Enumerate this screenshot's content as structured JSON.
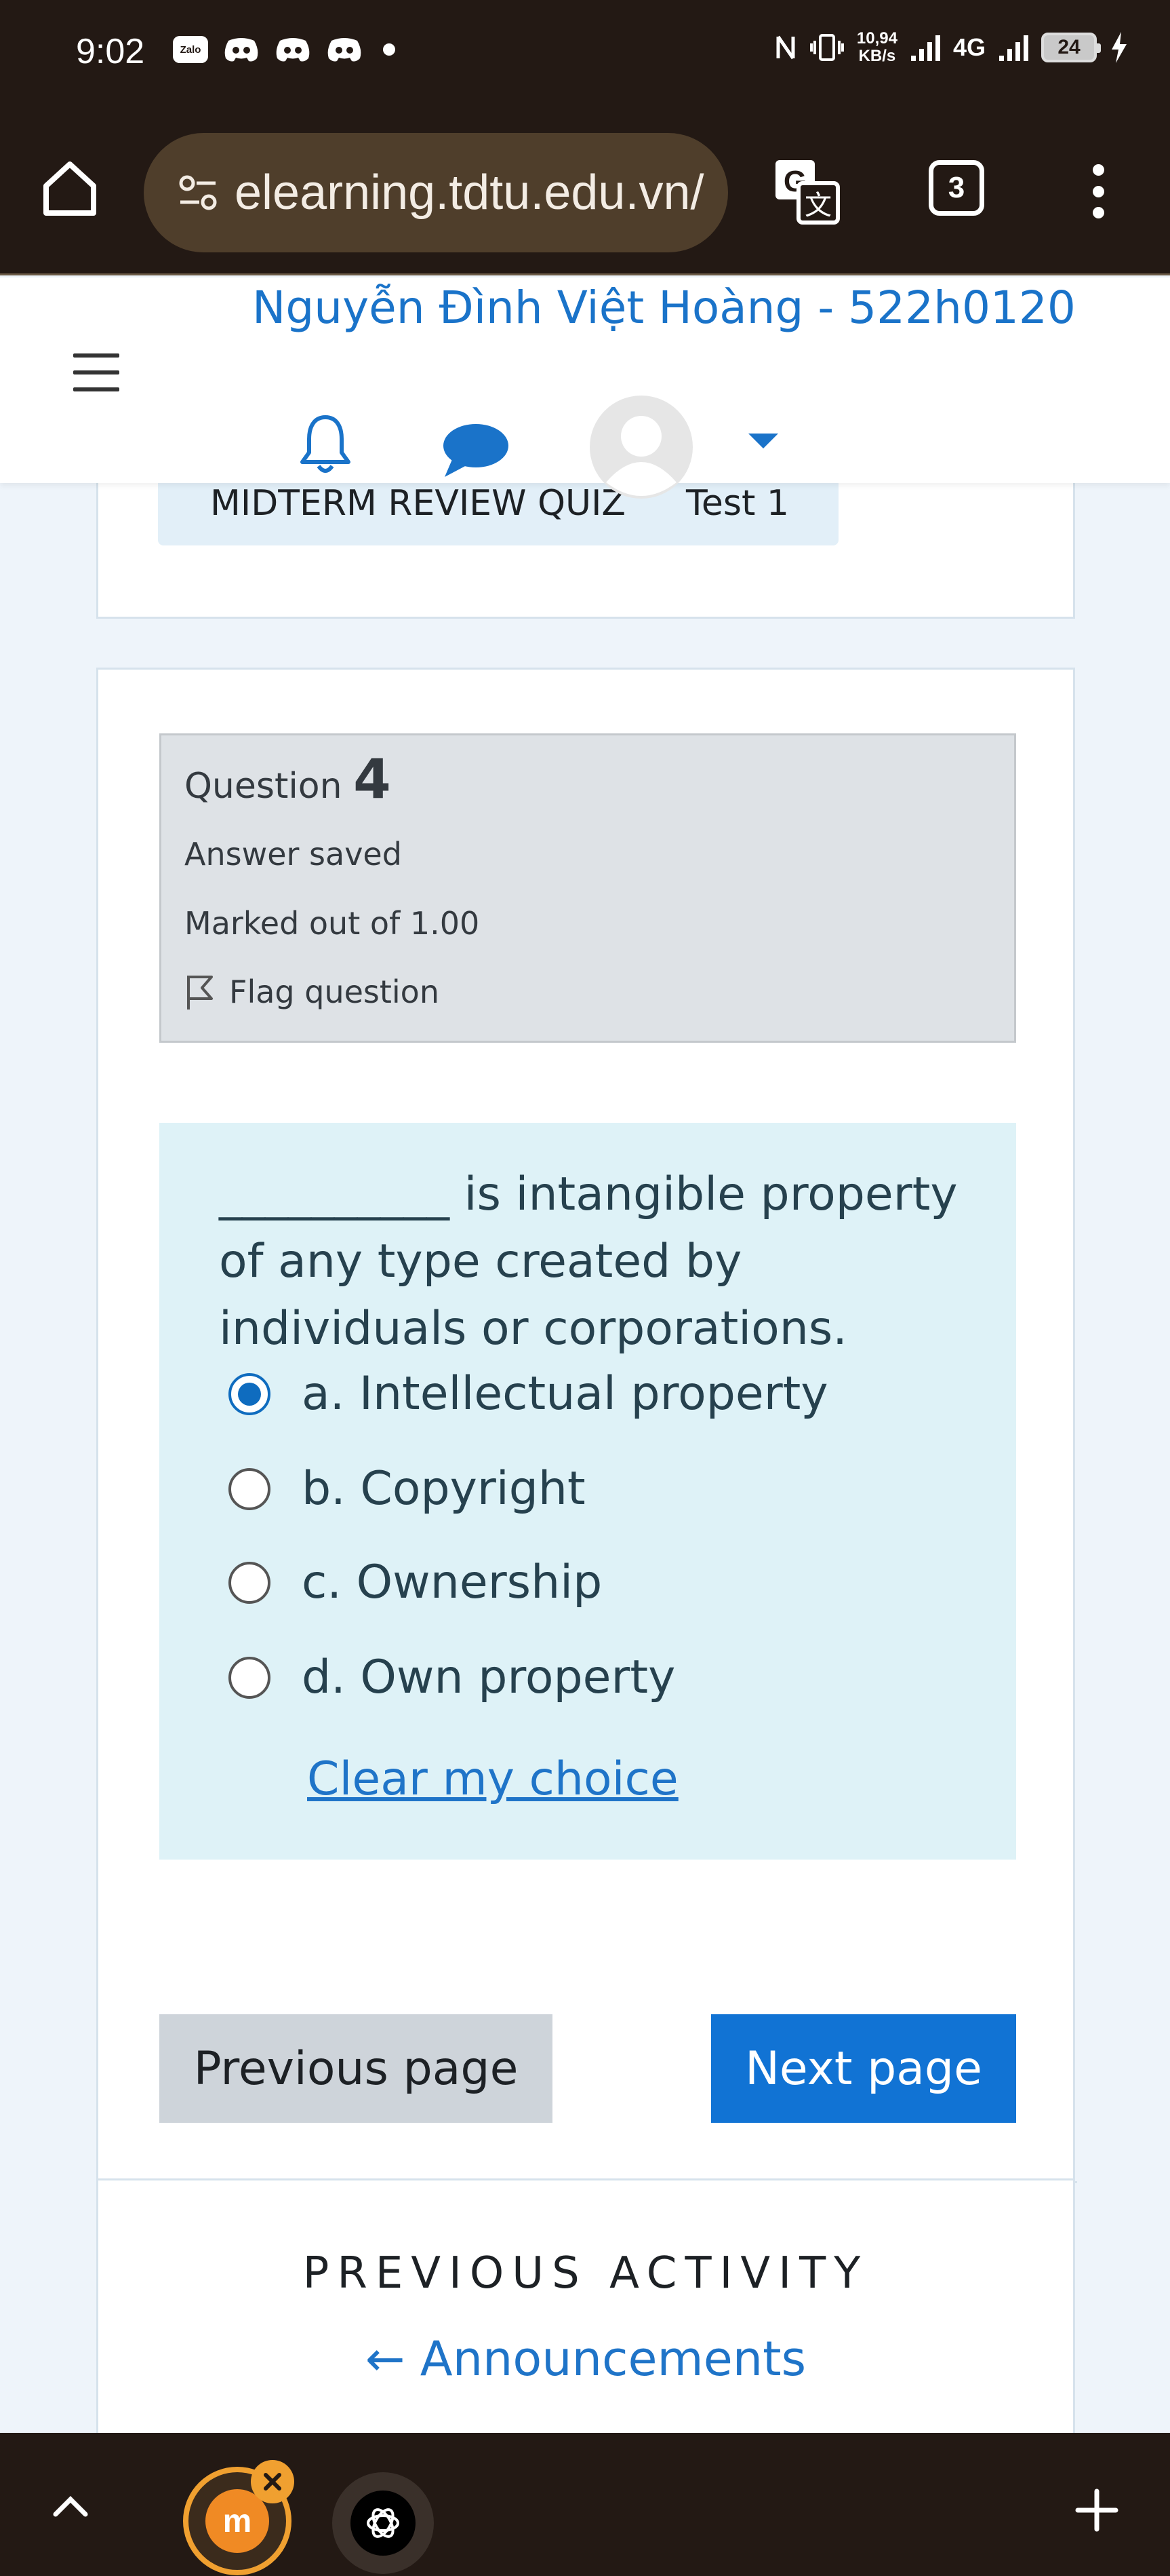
{
  "status_bar": {
    "time": "9:02",
    "app_badge": "Zalo",
    "speed_value": "10,94",
    "speed_unit": "KB/s",
    "network": "4G",
    "battery": "24"
  },
  "browser": {
    "url": "elearning.tdtu.edu.vn/",
    "tab_count": "3"
  },
  "header": {
    "user_name": "Nguyễn Đình Việt Hoàng - 522h0120"
  },
  "breadcrumb": {
    "quiz": "MIDTERM REVIEW QUIZ",
    "test": "Test 1"
  },
  "question": {
    "label": "Question",
    "number": "4",
    "state": "Answer saved",
    "grade": "Marked out of 1.00",
    "flag": "Flag question",
    "text": "__________ is intangible property of any type created by individuals or corporations.",
    "options": [
      {
        "label": "a. Intellectual property",
        "selected": true
      },
      {
        "label": "b. Copyright",
        "selected": false
      },
      {
        "label": "c. Ownership",
        "selected": false
      },
      {
        "label": "d. Own property",
        "selected": false
      }
    ],
    "clear": "Clear my choice"
  },
  "navigation": {
    "previous": "Previous page",
    "next": "Next page"
  },
  "previous_activity": {
    "title": "PREVIOUS ACTIVITY",
    "link": "← Announcements"
  },
  "colors": {
    "accent": "#1173d4",
    "link": "#1f74c8",
    "info_bg": "#dee2e6",
    "content_bg": "#def2f7"
  }
}
